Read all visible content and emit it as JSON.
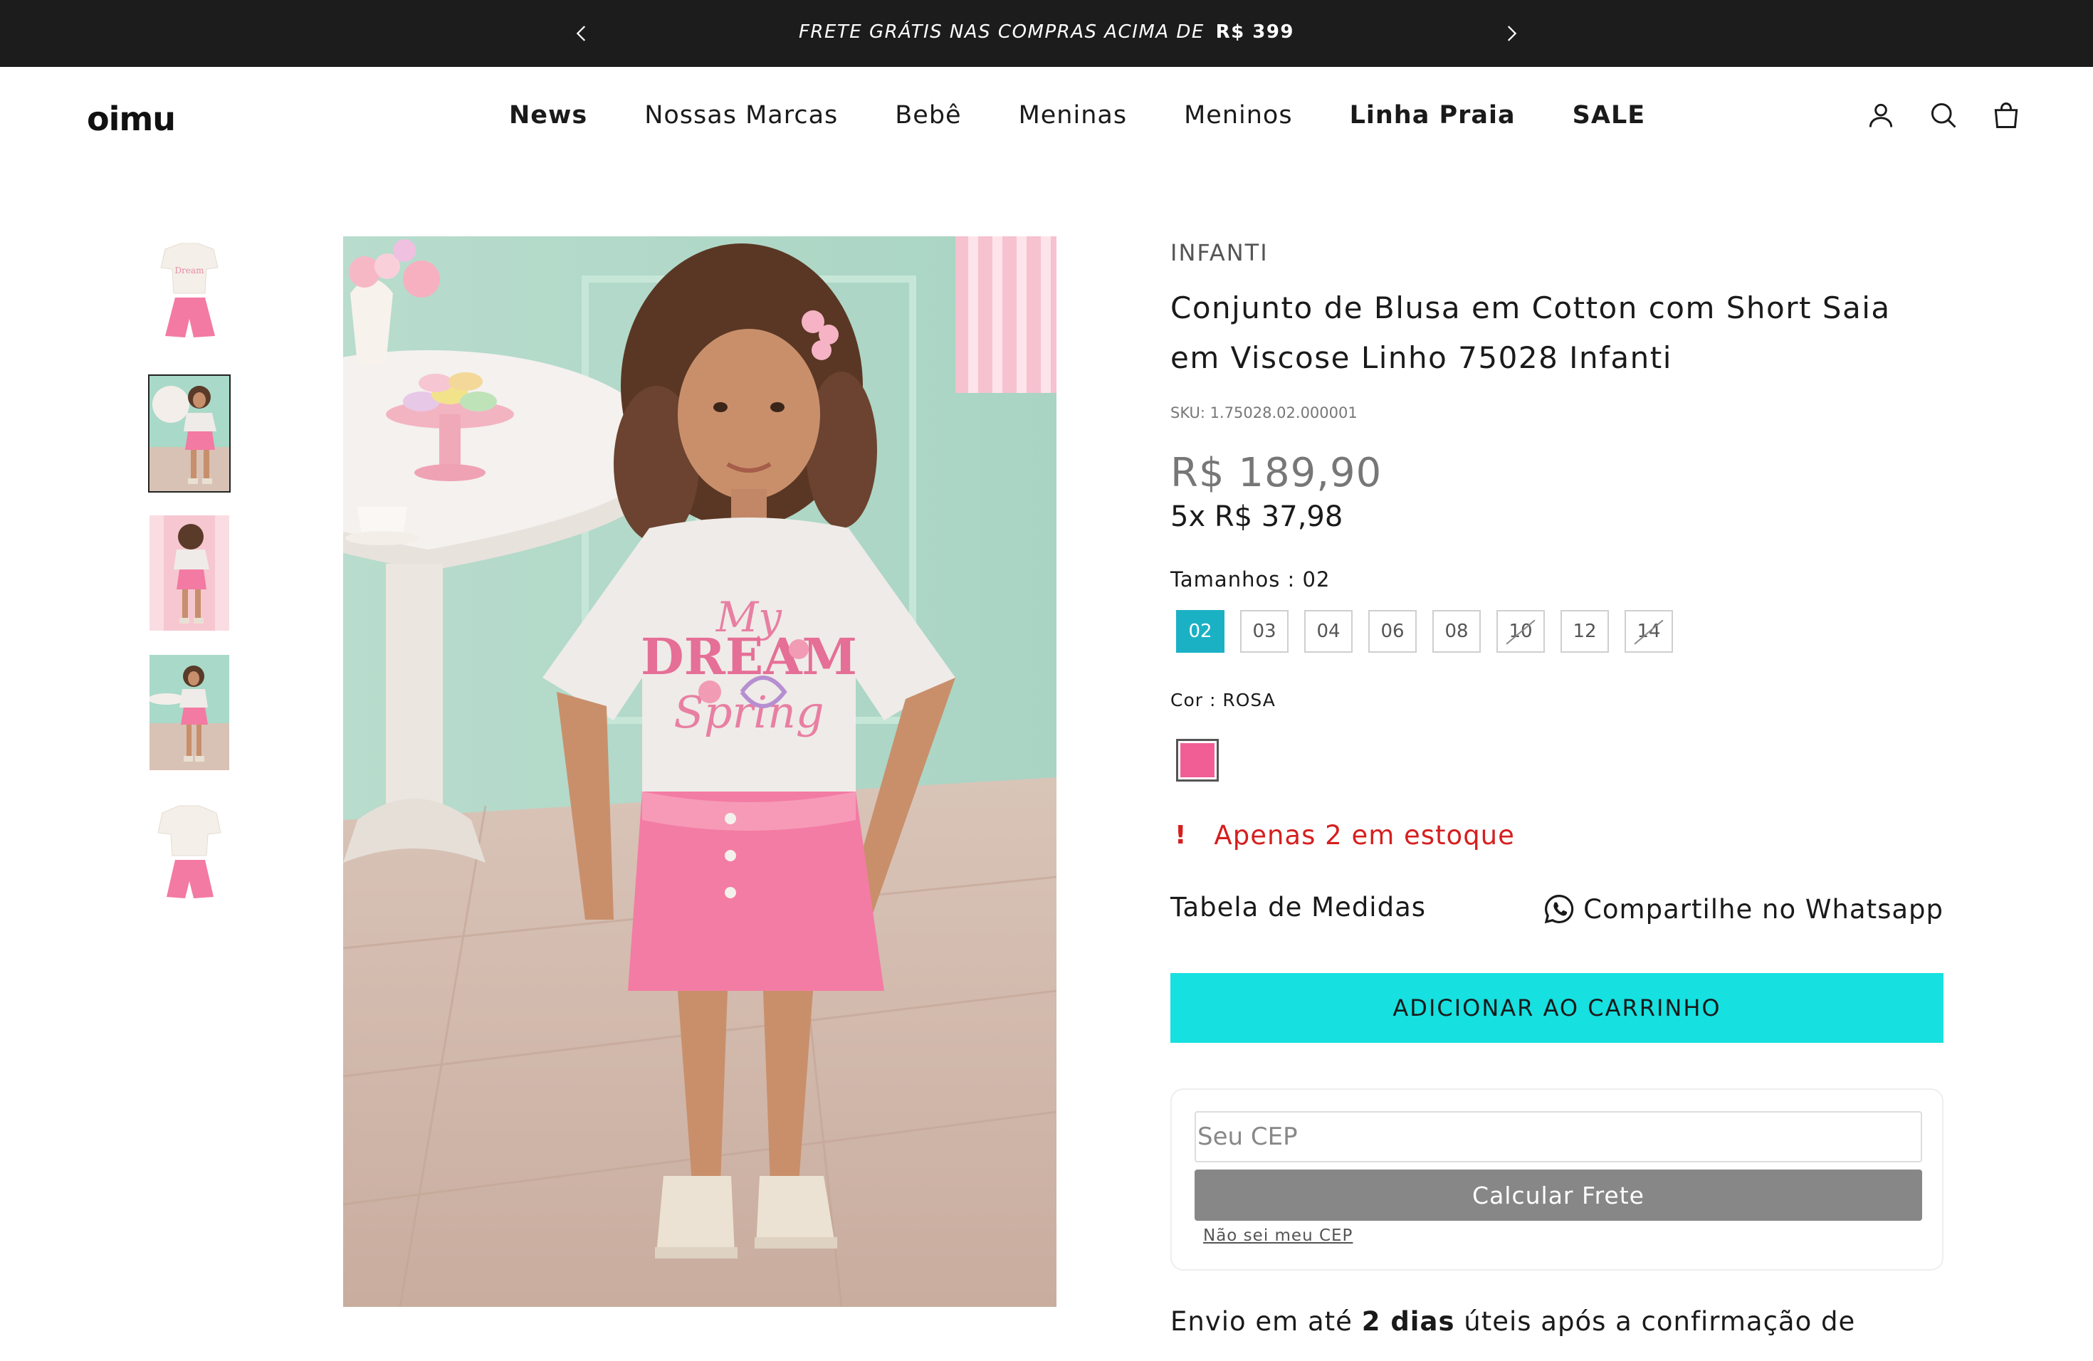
{
  "announcement": {
    "text": "FRETE GRÁTIS NAS COMPRAS ACIMA DE",
    "highlight": "R$ 399"
  },
  "header": {
    "logo": "oimu",
    "nav": [
      {
        "label": "News",
        "bold": true
      },
      {
        "label": "Nossas Marcas",
        "bold": false
      },
      {
        "label": "Bebê",
        "bold": false
      },
      {
        "label": "Meninas",
        "bold": false
      },
      {
        "label": "Meninos",
        "bold": false
      },
      {
        "label": "Linha Praia",
        "bold": true
      },
      {
        "label": "SALE",
        "bold": true
      }
    ],
    "icons": [
      "account-icon",
      "search-icon",
      "cart-icon"
    ]
  },
  "product": {
    "brand": "INFANTI",
    "title": "Conjunto de Blusa em Cotton com Short Saia em Viscose Linho 75028 Infanti",
    "sku": "SKU: 1.75028.02.000001",
    "price": "R$ 189,90",
    "installments": "5x R$ 37,98",
    "size_label": "Tamanhos : ",
    "size_selected": "02",
    "sizes": [
      {
        "label": "02",
        "state": "selected"
      },
      {
        "label": "03",
        "state": "available"
      },
      {
        "label": "04",
        "state": "available"
      },
      {
        "label": "06",
        "state": "available"
      },
      {
        "label": "08",
        "state": "available"
      },
      {
        "label": "10",
        "state": "unavailable"
      },
      {
        "label": "12",
        "state": "available"
      },
      {
        "label": "14",
        "state": "unavailable"
      }
    ],
    "color_label": "Cor : ",
    "color_selected": "ROSA",
    "color_hex": "#f15e96",
    "stock_text": "Apenas 2 em estoque",
    "measurements_link": "Tabela de Medidas",
    "whatsapp_share": "Compartilhe no Whatsapp",
    "add_to_cart": "ADICIONAR AO CARRINHO"
  },
  "freight": {
    "cep_placeholder": "Seu CEP",
    "calc_button": "Calcular Frete",
    "unknown_cep_link": "Não sei meu CEP"
  },
  "delivery": {
    "prefix": "Envio em até",
    "days": "2 dias",
    "suffix": "úteis após a confirmação de"
  },
  "colors": {
    "accent_button": "#16e0e0",
    "selected_size": "#1bb1c5",
    "stock_warning": "#d51f1f",
    "announcement_bg": "#1c1c1c"
  }
}
